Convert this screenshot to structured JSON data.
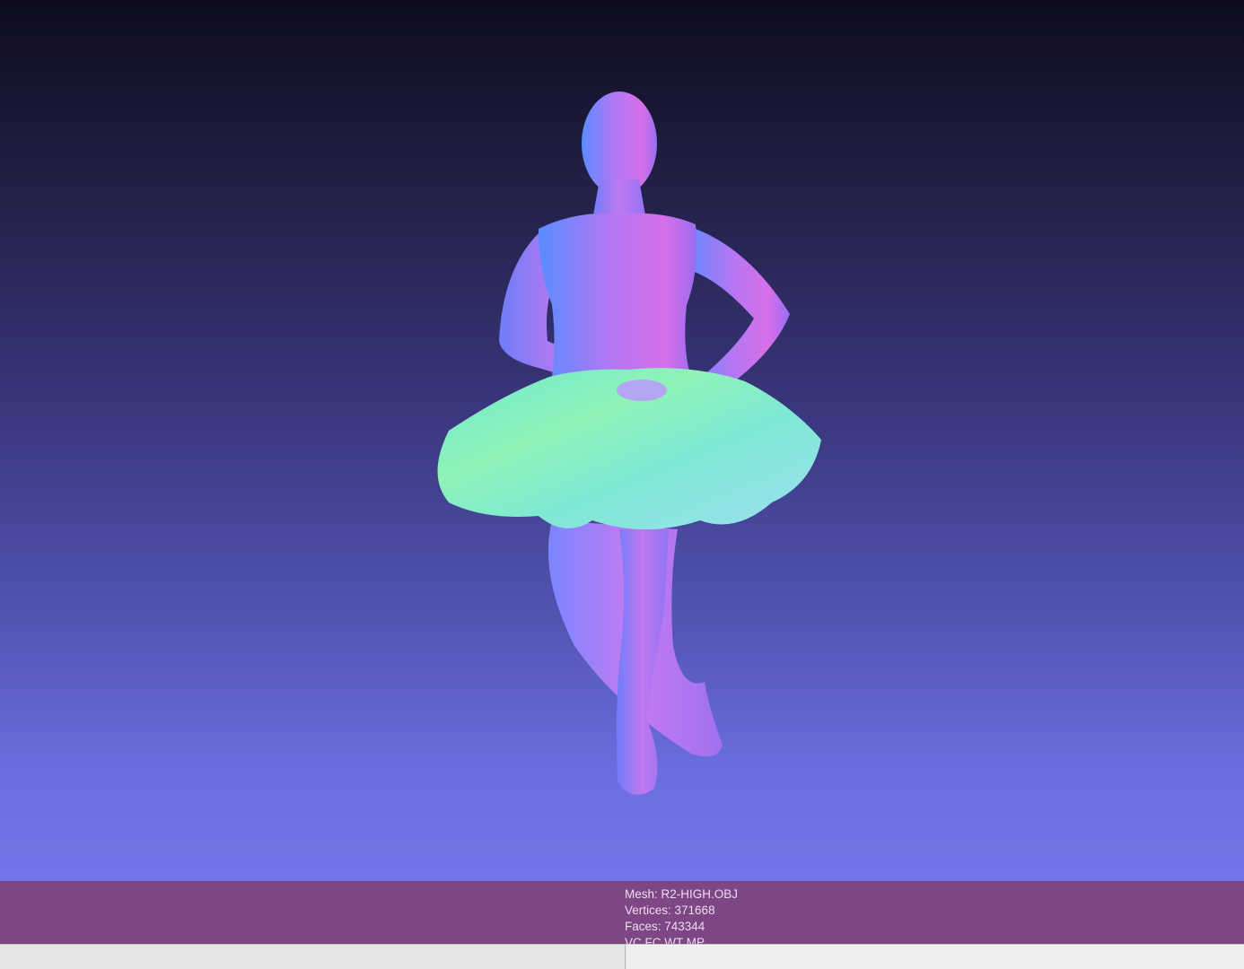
{
  "info": {
    "mesh": "Mesh: R2-HIGH.OBJ",
    "vertices": "Vertices: 371668",
    "faces": "Faces: 743344",
    "flags": "VC FC WT MP"
  },
  "colors": {
    "info_bar": "#7e4684",
    "viewport_top": "#0d0c1e",
    "viewport_bottom": "#7276ea",
    "status_bar": "#e6e6e6"
  }
}
